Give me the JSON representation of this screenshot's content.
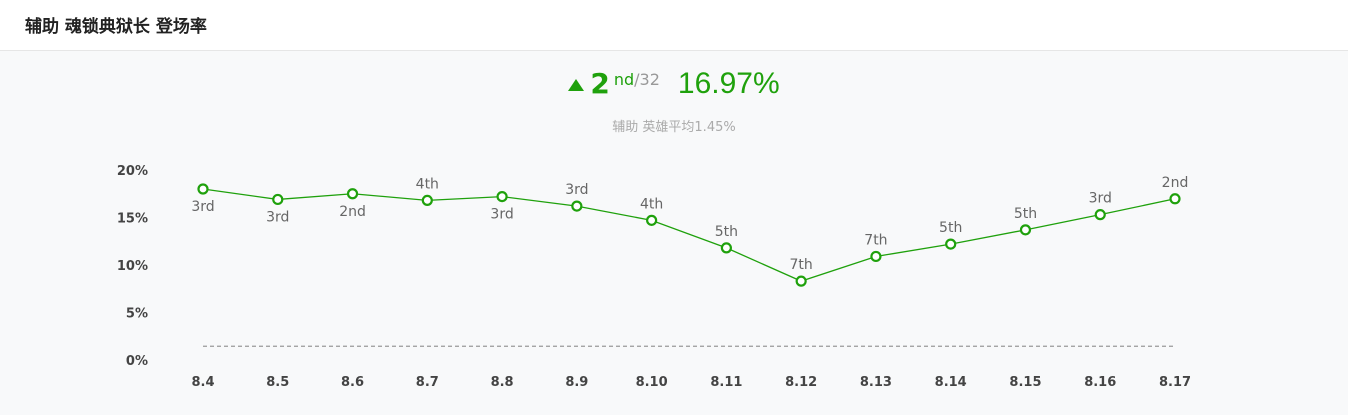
{
  "header": {
    "title": "辅助 魂锁典狱长 登场率"
  },
  "summary": {
    "rank": "2",
    "rank_suffix": "nd",
    "rank_total": "/32",
    "rate": "16.97%",
    "subtitle": "辅助 英雄平均1.45%"
  },
  "colors": {
    "accent": "#1fa10c",
    "average_line": "#999999"
  },
  "chart_data": {
    "type": "line",
    "categories": [
      "8.4",
      "8.5",
      "8.6",
      "8.7",
      "8.8",
      "8.9",
      "8.10",
      "8.11",
      "8.12",
      "8.13",
      "8.14",
      "8.15",
      "8.16",
      "8.17"
    ],
    "series": [
      {
        "values": [
          18.0,
          16.9,
          17.5,
          16.8,
          17.2,
          16.2,
          14.7,
          11.8,
          8.3,
          10.9,
          12.2,
          13.7,
          15.3,
          16.97
        ],
        "point_labels": [
          "3rd",
          "3rd",
          "2nd",
          "4th",
          "3rd",
          "3rd",
          "4th",
          "5th",
          "7th",
          "7th",
          "5th",
          "5th",
          "3rd",
          "2nd"
        ],
        "label_positions": [
          "below",
          "below",
          "below",
          "above",
          "below",
          "above",
          "above",
          "above",
          "above",
          "above",
          "above",
          "above",
          "above",
          "above"
        ]
      }
    ],
    "reference_line": {
      "value": 1.45,
      "style": "dashed"
    },
    "yticks": [
      "0%",
      "5%",
      "10%",
      "15%",
      "20%"
    ],
    "ytick_values": [
      0,
      5,
      10,
      15,
      20
    ],
    "ylim": [
      0,
      20
    ],
    "grid": false
  }
}
